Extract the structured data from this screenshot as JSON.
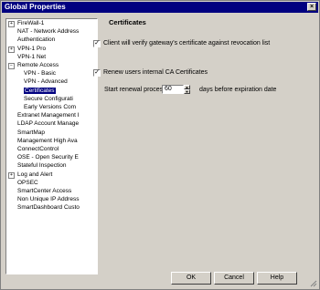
{
  "window": {
    "title": "Global Properties"
  },
  "tree": [
    {
      "label": "FireWall-1",
      "expander": "+",
      "selected": false
    },
    {
      "label": "NAT - Network Address",
      "expander": "",
      "selected": false
    },
    {
      "label": "Authentication",
      "expander": "",
      "selected": false
    },
    {
      "label": "VPN-1 Pro",
      "expander": "+",
      "selected": false
    },
    {
      "label": "VPN-1 Net",
      "expander": "",
      "selected": false
    },
    {
      "label": "Remote Access",
      "expander": "−",
      "selected": false
    },
    {
      "label": "VPN - Basic",
      "expander": "",
      "selected": false
    },
    {
      "label": "VPN - Advanced",
      "expander": "",
      "selected": false
    },
    {
      "label": "Certificates",
      "expander": "",
      "selected": true
    },
    {
      "label": "Secure Configurati",
      "expander": "",
      "selected": false
    },
    {
      "label": "Early Versions Com",
      "expander": "",
      "selected": false
    },
    {
      "label": "Extranet Management I",
      "expander": "",
      "selected": false
    },
    {
      "label": "LDAP Account Manage",
      "expander": "",
      "selected": false
    },
    {
      "label": "SmartMap",
      "expander": "",
      "selected": false
    },
    {
      "label": "Management High Ava",
      "expander": "",
      "selected": false
    },
    {
      "label": "ConnectControl",
      "expander": "",
      "selected": false
    },
    {
      "label": "OSE - Open Security E",
      "expander": "",
      "selected": false
    },
    {
      "label": "Stateful Inspection",
      "expander": "",
      "selected": false
    },
    {
      "label": "Log and Alert",
      "expander": "+",
      "selected": false
    },
    {
      "label": "OPSEC",
      "expander": "",
      "selected": false
    },
    {
      "label": "SmartCenter Access",
      "expander": "",
      "selected": false
    },
    {
      "label": "Non Unique IP Address",
      "expander": "",
      "selected": false
    },
    {
      "label": "SmartDashboard Custo",
      "expander": "",
      "selected": false
    }
  ],
  "panel": {
    "title": "Certificates",
    "client_verify": {
      "label": "Client will verify gateway's certificate against revocation list",
      "checked": true
    },
    "renew_certs": {
      "label": "Renew users internal CA Certificates",
      "checked": true
    },
    "renewal": {
      "label": "Start renewal process",
      "value": "60",
      "suffix": "days before expiration date"
    }
  },
  "buttons": {
    "ok": "OK",
    "cancel": "Cancel",
    "help": "Help"
  }
}
